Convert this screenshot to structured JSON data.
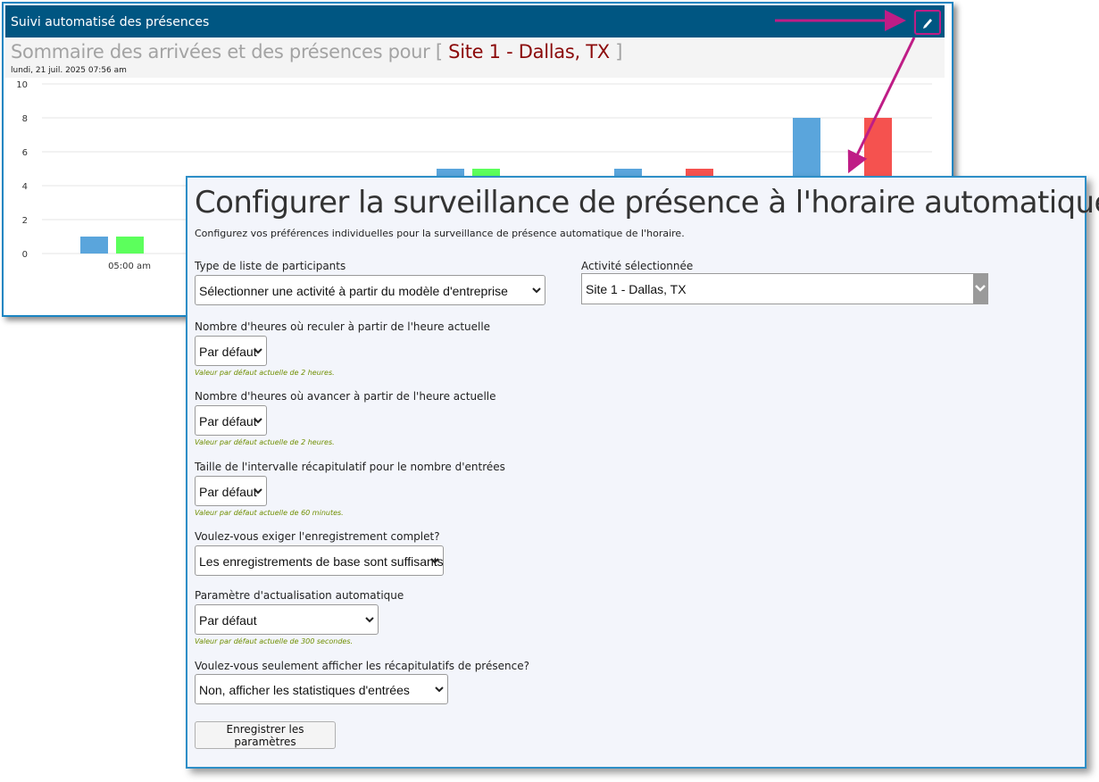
{
  "widget": {
    "title": "Suivi automatisé des présences",
    "edit_icon": "pencil-icon",
    "summary_prefix": "Sommaire des arrivées et des présences pour ",
    "bracket_open": "[",
    "site": " Site 1 - Dallas, TX ",
    "bracket_close": "]",
    "date": "lundi, 21 juil. 2025 07:56 am"
  },
  "chart_data": {
    "type": "bar",
    "ylim": [
      0,
      10
    ],
    "y_ticks": [
      "10",
      "8",
      "6",
      "4",
      "2",
      "0"
    ],
    "x_ticks": [
      "05:00 am"
    ],
    "grid": true,
    "series": [
      {
        "color": "#5aa5dc",
        "values": [
          1,
          null,
          5,
          5,
          8
        ]
      },
      {
        "color": "#5cff5c",
        "values": [
          1,
          null,
          5,
          null,
          null
        ]
      },
      {
        "color": "#f5524f",
        "values": [
          null,
          null,
          null,
          5,
          8
        ]
      }
    ]
  },
  "dialog": {
    "title": "Configurer la surveillance de présence à l'horaire automatique",
    "subtitle": "Configurez vos préférences individuelles pour la surveillance de présence automatique de l'horaire.",
    "roster_type_label": "Type de liste de participants",
    "roster_type_value": "Sélectionner une activité à partir du modèle d'entreprise",
    "activity_label": "Activité sélectionnée",
    "activity_value": "Site 1 - Dallas, TX",
    "hours_back_label": "Nombre d'heures où reculer à partir de l'heure actuelle",
    "hours_back_value": "Par défaut",
    "hours_back_hint": "Valeur par défaut actuelle de 2 heures.",
    "hours_forward_label": "Nombre d'heures où avancer à partir de l'heure actuelle",
    "hours_forward_value": "Par défaut",
    "hours_forward_hint": "Valeur par défaut actuelle de 2 heures.",
    "interval_label": "Taille de l'intervalle récapitulatif pour le nombre d'entrées",
    "interval_value": "Par défaut",
    "interval_hint": "Valeur par défaut actuelle de 60 minutes.",
    "registration_label": "Voulez-vous exiger l'enregistrement complet?",
    "registration_value": "Les enregistrements de base sont suffisants",
    "refresh_label": "Paramètre d'actualisation automatique",
    "refresh_value": "Par défaut",
    "refresh_hint": "Valeur par défaut actuelle de 300 secondes.",
    "summary_only_label": "Voulez-vous seulement afficher les récapitulatifs de présence?",
    "summary_only_value": "Non, afficher les statistiques d'entrées",
    "save_label": "Enregistrer les paramètres"
  },
  "colors": {
    "header_bg": "#005682",
    "accent_border": "#2d8ec7",
    "highlight": "#bf1d86",
    "site_text": "#8b0a0a",
    "hint_text": "#6f8e00"
  }
}
